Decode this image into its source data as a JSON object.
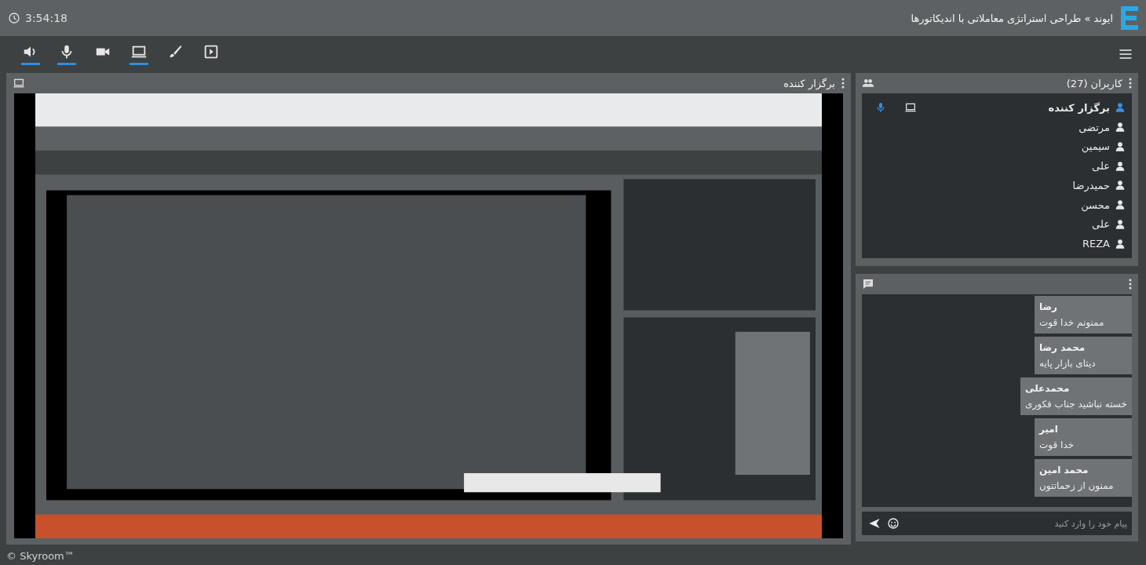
{
  "header": {
    "clock": "3:54:18",
    "title": "ایوند » طراحی استراتژی معاملاتی با اندیکاتورها"
  },
  "toolbar": [
    {
      "kind": "speaker",
      "active": true
    },
    {
      "kind": "mic",
      "active": true
    },
    {
      "kind": "camera",
      "active": false
    },
    {
      "kind": "screen",
      "active": true
    },
    {
      "kind": "brush",
      "active": false
    },
    {
      "kind": "media",
      "active": false
    }
  ],
  "screen_panel": {
    "title": "برگزار کننده"
  },
  "users_panel": {
    "title": "کاربران (27)",
    "users": [
      {
        "name": "برگزار کننده",
        "presenter": true
      },
      {
        "name": "مرتضی",
        "presenter": false
      },
      {
        "name": "سیمین",
        "presenter": false
      },
      {
        "name": "علی",
        "presenter": false
      },
      {
        "name": "حمیدرضا",
        "presenter": false
      },
      {
        "name": "محسن",
        "presenter": false
      },
      {
        "name": "علی",
        "presenter": false
      },
      {
        "name": "REZA",
        "presenter": false
      }
    ]
  },
  "chat_panel": {
    "messages": [
      {
        "sender": "رضا",
        "text": "ممنونم خدا قوت"
      },
      {
        "sender": "محمد رضا",
        "text": "دیتای بازار پایه"
      },
      {
        "sender": "محمدعلی",
        "text": "خسته نباشید جناب فکوری"
      },
      {
        "sender": "امیر",
        "text": "خدا قوت"
      },
      {
        "sender": "محمد امین",
        "text": "ممنون از زحماتتون"
      }
    ],
    "input": {
      "placeholder": "پیام خود را وارد کنید"
    }
  },
  "footer": "© Skyroom™"
}
